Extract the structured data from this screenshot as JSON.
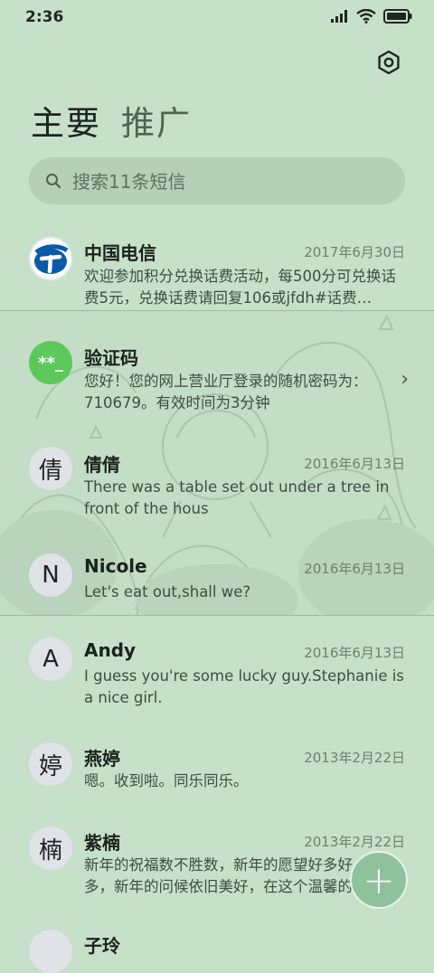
{
  "status_bar": {
    "time": "2:36",
    "icons": [
      "signal-icon",
      "wifi-icon",
      "battery-icon"
    ]
  },
  "header": {
    "settings_icon": "settings-hex-icon"
  },
  "tabs": [
    {
      "label": "主要",
      "active": true
    },
    {
      "label": "推广",
      "active": false
    }
  ],
  "search": {
    "placeholder": "搜索11条短信",
    "value": ""
  },
  "messages": [
    {
      "name": "中国电信",
      "date": "2017年6月30日",
      "preview": "欢迎参加积分兑换话费活动，每500分可兑换话费5元，兑换话费请回复106或jfdh#话费…",
      "avatar": "china-telecom-logo"
    },
    {
      "name": "验证码",
      "date": "",
      "preview": "您好！您的网上营业厅登录的随机密码为：710679。有效时间为3分钟",
      "avatar_text": "**_"
    },
    {
      "name": "倩倩",
      "date": "2016年6月13日",
      "preview": "There was a table set out under a tree in front of the hous",
      "avatar_text": "倩"
    },
    {
      "name": "Nicole",
      "date": "2016年6月13日",
      "preview": "Let's eat out,shall we?",
      "avatar_text": "N"
    },
    {
      "name": "Andy",
      "date": "2016年6月13日",
      "preview": "I guess you're some lucky guy.Stephanie is a nice girl.",
      "avatar_text": "A"
    },
    {
      "name": "燕婷",
      "date": "2013年2月22日",
      "preview": "嗯。收到啦。同乐同乐。",
      "avatar_text": "婷"
    },
    {
      "name": "紫楠",
      "date": "2013年2月22日",
      "preview": "新年的祝福数不胜数，新年的愿望好多好多，新年的问候依旧美好，在这个温馨的时刻",
      "avatar_text": "楠"
    },
    {
      "name": "子玲",
      "date": "",
      "preview": "",
      "avatar_text": ""
    }
  ],
  "fab": {
    "label": "+"
  },
  "colors": {
    "background": "#c6e0c9",
    "fab": "#8fc29c",
    "verify_avatar": "#5cc95a",
    "telecom_blue": "#0a5aa8"
  }
}
